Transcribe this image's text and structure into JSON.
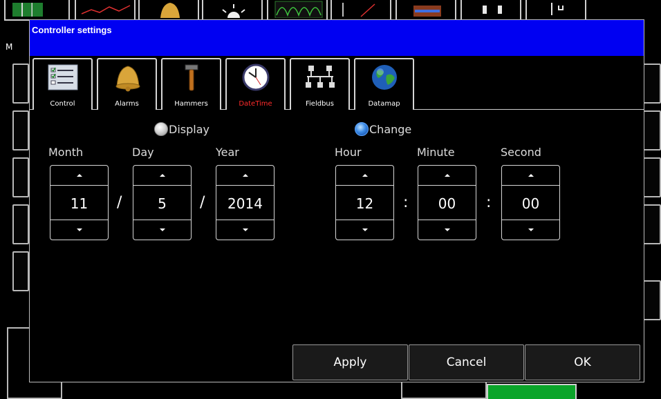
{
  "colors": {
    "title_bar": "#0000f2",
    "active_tab_label": "#ff2b2b",
    "radio_selected": "#3b8ae6",
    "status_green": "#0ba52a"
  },
  "background_app": {
    "toolbar_icons": [
      "bar-chart-icon",
      "line-graph-icon",
      "bell-icon",
      "sun-icon",
      "waveform-icon",
      "trend-icon",
      "tray-icon",
      "plug-icon",
      "wrench-icon"
    ],
    "left_partial_label": "M"
  },
  "dialog": {
    "title": "Controller settings",
    "tabs": [
      {
        "label": "Control",
        "icon": "checklist-icon"
      },
      {
        "label": "Alarms",
        "icon": "bell-icon"
      },
      {
        "label": "Hammers",
        "icon": "hammer-icon"
      },
      {
        "label": "DateTime",
        "icon": "clock-icon",
        "active": true
      },
      {
        "label": "Fieldbus",
        "icon": "network-icon"
      },
      {
        "label": "Datamap",
        "icon": "globe-icon"
      }
    ],
    "mode": {
      "display_label": "Display",
      "change_label": "Change",
      "selected": "Change"
    },
    "date": {
      "month_label": "Month",
      "day_label": "Day",
      "year_label": "Year",
      "month": "11",
      "day": "5",
      "year": "2014",
      "separator": "/"
    },
    "time": {
      "hour_label": "Hour",
      "minute_label": "Minute",
      "second_label": "Second",
      "hour": "12",
      "minute": "00",
      "second": "00",
      "separator": ":"
    },
    "buttons": {
      "apply": "Apply",
      "cancel": "Cancel",
      "ok": "OK"
    }
  }
}
